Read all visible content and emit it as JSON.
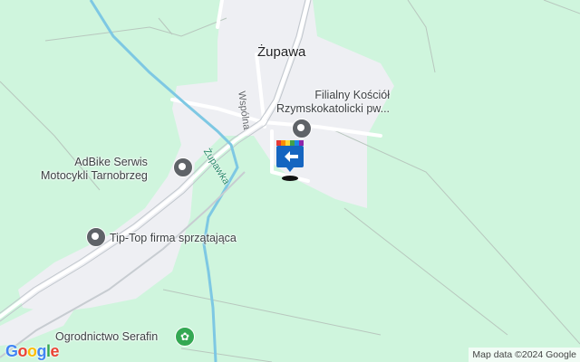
{
  "map": {
    "place_title": "Żupawa",
    "road_label": "Wspólna",
    "river_label": "Żupawka",
    "pois": [
      {
        "label_line1": "Filialny Kościół",
        "label_line2": "Rzymskokatolicki pw...",
        "icon": "cross-icon"
      },
      {
        "label_line1": "AdBike Serwis",
        "label_line2": "Motocykli Tarnobrzeg",
        "icon": "place-pin-icon"
      },
      {
        "label_line1": "Tip-Top firma sprzątająca",
        "icon": "place-pin-icon"
      },
      {
        "label_line1": "Ogrodnictwo Serafin",
        "icon": "flower-icon"
      }
    ],
    "google_logo": [
      "G",
      "o",
      "o",
      "g",
      "l",
      "e"
    ],
    "attribution": "Map data ©2024 Google",
    "colors": {
      "background": "#cff5dd",
      "settlement": "#eeeff3",
      "road": "#ffffff",
      "river": "#7ec8e3",
      "logo_blue": "#4285F4",
      "logo_red": "#EA4335",
      "logo_yellow": "#FBBC05",
      "logo_green": "#34A853"
    }
  }
}
